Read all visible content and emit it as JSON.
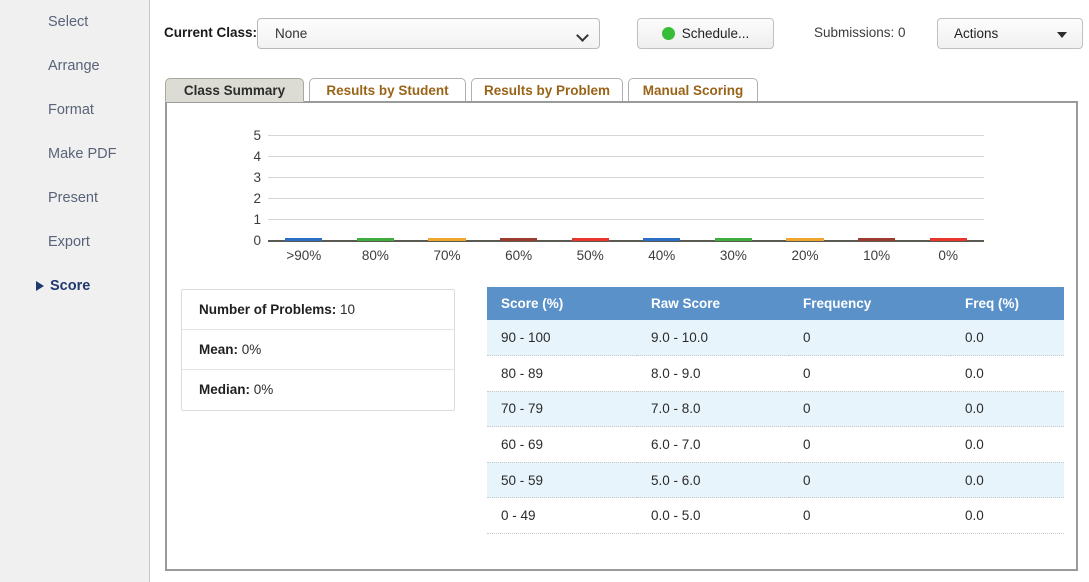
{
  "sidebar": {
    "items": [
      {
        "label": "Select",
        "active": false
      },
      {
        "label": "Arrange",
        "active": false
      },
      {
        "label": "Format",
        "active": false
      },
      {
        "label": "Make PDF",
        "active": false
      },
      {
        "label": "Present",
        "active": false
      },
      {
        "label": "Export",
        "active": false
      },
      {
        "label": "Score",
        "active": true
      }
    ]
  },
  "toolbar": {
    "current_class_label": "Current Class:",
    "class_select_value": "None",
    "schedule_button": "Schedule...",
    "schedule_status_color": "#37bd38",
    "submissions_text": "Submissions: 0",
    "actions_button": "Actions"
  },
  "tabs": [
    {
      "label": "Class Summary",
      "active": true
    },
    {
      "label": "Results by Student",
      "active": false
    },
    {
      "label": "Results by Problem",
      "active": false
    },
    {
      "label": "Manual Scoring",
      "active": false
    }
  ],
  "stats": [
    {
      "label": "Number of Problems:",
      "value": "10"
    },
    {
      "label": "Mean:",
      "value": "0%"
    },
    {
      "label": "Median:",
      "value": "0%"
    }
  ],
  "table": {
    "headers": [
      "Score (%)",
      "Raw Score",
      "Frequency",
      "Freq (%)"
    ],
    "header_bg": "#5b91c9",
    "rows": [
      {
        "score": "90 - 100",
        "raw": "9.0 - 10.0",
        "frequency": "0",
        "freq_pct": "0.0"
      },
      {
        "score": "80 - 89",
        "raw": "8.0 - 9.0",
        "frequency": "0",
        "freq_pct": "0.0"
      },
      {
        "score": "70 - 79",
        "raw": "7.0 - 8.0",
        "frequency": "0",
        "freq_pct": "0.0"
      },
      {
        "score": "60 - 69",
        "raw": "6.0 - 7.0",
        "frequency": "0",
        "freq_pct": "0.0"
      },
      {
        "score": "50 - 59",
        "raw": "5.0 - 6.0",
        "frequency": "0",
        "freq_pct": "0.0"
      },
      {
        "score": "0 - 49",
        "raw": "0.0 - 5.0",
        "frequency": "0",
        "freq_pct": "0.0"
      }
    ]
  },
  "chart_data": {
    "type": "bar",
    "title": "",
    "xlabel": "",
    "ylabel": "",
    "categories": [
      ">90%",
      "80%",
      "70%",
      "60%",
      "50%",
      "40%",
      "30%",
      "20%",
      "10%",
      "0%"
    ],
    "values": [
      0,
      0,
      0,
      0,
      0,
      0,
      0,
      0,
      0,
      0
    ],
    "colors": [
      "#2a6fc4",
      "#3fae3f",
      "#f0a62c",
      "#9c3b30",
      "#e8362c",
      "#2a6fc4",
      "#3fae3f",
      "#f0a62c",
      "#9c3b30",
      "#e8362c"
    ],
    "ylim": [
      0,
      5
    ],
    "yticks": [
      0,
      1,
      2,
      3,
      4,
      5
    ],
    "grid": true,
    "legend": false
  }
}
